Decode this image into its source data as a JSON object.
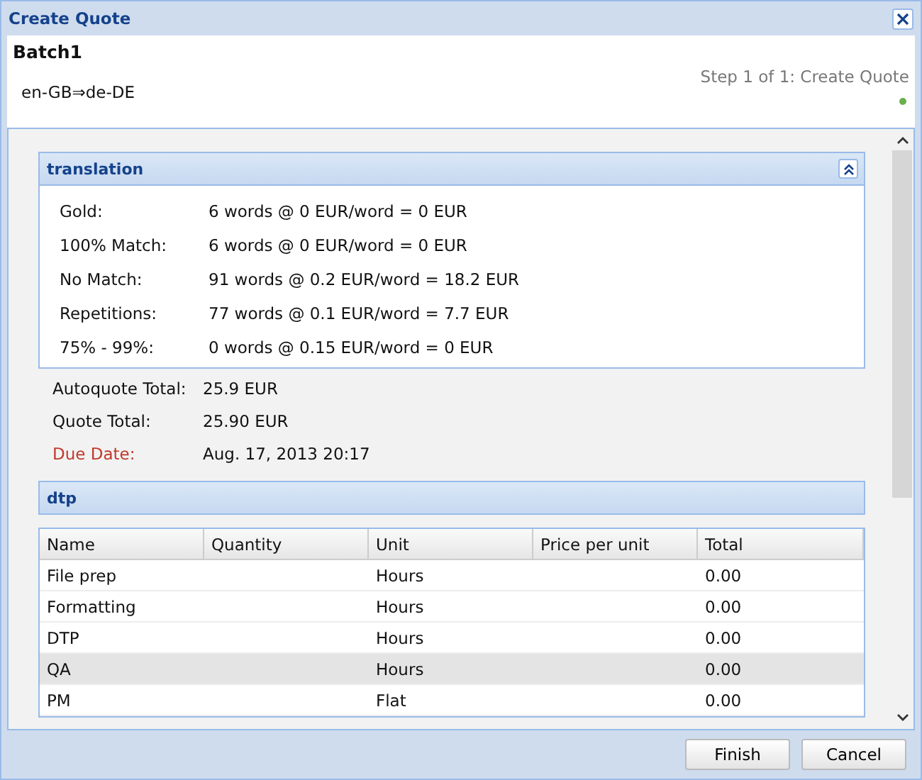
{
  "window": {
    "title": "Create Quote"
  },
  "header": {
    "title": "Batch1",
    "language_pair": "en-GB⇒de-DE",
    "step": "Step 1 of 1: Create Quote"
  },
  "translation": {
    "title": "translation",
    "expanded": true,
    "rows": [
      {
        "label": "Gold:",
        "value": "6 words @ 0 EUR/word = 0 EUR"
      },
      {
        "label": "100% Match:",
        "value": "6 words @ 0 EUR/word = 0 EUR"
      },
      {
        "label": "No Match:",
        "value": "91 words @ 0.2 EUR/word = 18.2 EUR"
      },
      {
        "label": "Repetitions:",
        "value": "77 words @ 0.1 EUR/word = 7.7 EUR"
      },
      {
        "label": "75% - 99%:",
        "value": "0 words @ 0.15 EUR/word = 0 EUR"
      }
    ]
  },
  "totals": [
    {
      "label": "Autoquote Total:",
      "value": "25.9 EUR",
      "kind": "normal"
    },
    {
      "label": "Quote Total:",
      "value": "25.90 EUR",
      "kind": "normal"
    },
    {
      "label": "Due Date:",
      "value": "Aug. 17, 2013 20:17",
      "kind": "warning"
    }
  ],
  "dtp": {
    "title": "dtp",
    "table": {
      "columns": [
        "Name",
        "Quantity",
        "Unit",
        "Price per unit",
        "Total"
      ],
      "rows": [
        {
          "cells": [
            "File prep",
            "",
            "Hours",
            "",
            "0.00"
          ],
          "selected": false
        },
        {
          "cells": [
            "Formatting",
            "",
            "Hours",
            "",
            "0.00"
          ],
          "selected": false
        },
        {
          "cells": [
            "DTP",
            "",
            "Hours",
            "",
            "0.00"
          ],
          "selected": false
        },
        {
          "cells": [
            "QA",
            "",
            "Hours",
            "",
            "0.00"
          ],
          "selected": true
        },
        {
          "cells": [
            "PM",
            "",
            "Flat",
            "",
            "0.00"
          ],
          "selected": false
        }
      ]
    }
  },
  "buttons": [
    "Finish",
    "Cancel"
  ]
}
